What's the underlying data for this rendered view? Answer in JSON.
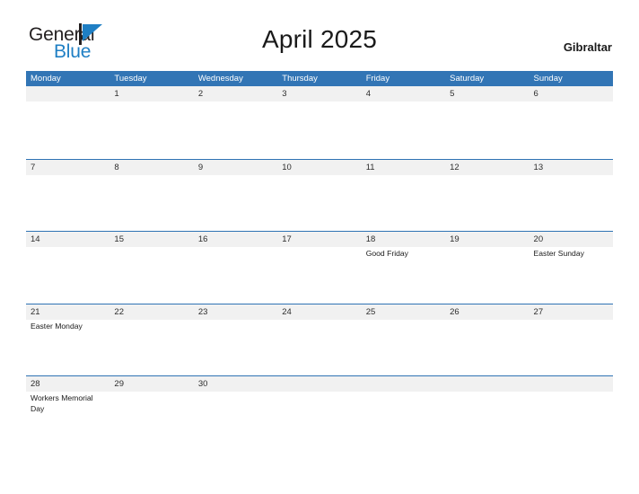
{
  "brand": {
    "name_part1": "General",
    "name_part2": "Blue",
    "mark": "triangle-icon"
  },
  "header": {
    "title": "April 2025",
    "country": "Gibraltar"
  },
  "colors": {
    "header_blue": "#3275b5",
    "rule_blue": "#2f73b4",
    "band_gray": "#f1f1f1",
    "logo_blue": "#1f7fc4",
    "text_dark": "#1a1a1a"
  },
  "calendar": {
    "weekdays": [
      "Monday",
      "Tuesday",
      "Wednesday",
      "Thursday",
      "Friday",
      "Saturday",
      "Sunday"
    ],
    "weeks": [
      [
        {
          "date": "",
          "events": []
        },
        {
          "date": "1",
          "events": []
        },
        {
          "date": "2",
          "events": []
        },
        {
          "date": "3",
          "events": []
        },
        {
          "date": "4",
          "events": []
        },
        {
          "date": "5",
          "events": []
        },
        {
          "date": "6",
          "events": []
        }
      ],
      [
        {
          "date": "7",
          "events": []
        },
        {
          "date": "8",
          "events": []
        },
        {
          "date": "9",
          "events": []
        },
        {
          "date": "10",
          "events": []
        },
        {
          "date": "11",
          "events": []
        },
        {
          "date": "12",
          "events": []
        },
        {
          "date": "13",
          "events": []
        }
      ],
      [
        {
          "date": "14",
          "events": []
        },
        {
          "date": "15",
          "events": []
        },
        {
          "date": "16",
          "events": []
        },
        {
          "date": "17",
          "events": []
        },
        {
          "date": "18",
          "events": [
            "Good Friday"
          ]
        },
        {
          "date": "19",
          "events": []
        },
        {
          "date": "20",
          "events": [
            "Easter Sunday"
          ]
        }
      ],
      [
        {
          "date": "21",
          "events": [
            "Easter Monday"
          ]
        },
        {
          "date": "22",
          "events": []
        },
        {
          "date": "23",
          "events": []
        },
        {
          "date": "24",
          "events": []
        },
        {
          "date": "25",
          "events": []
        },
        {
          "date": "26",
          "events": []
        },
        {
          "date": "27",
          "events": []
        }
      ],
      [
        {
          "date": "28",
          "events": [
            "Workers Memorial Day"
          ]
        },
        {
          "date": "29",
          "events": []
        },
        {
          "date": "30",
          "events": []
        },
        {
          "date": "",
          "events": []
        },
        {
          "date": "",
          "events": []
        },
        {
          "date": "",
          "events": []
        },
        {
          "date": "",
          "events": []
        }
      ]
    ]
  }
}
